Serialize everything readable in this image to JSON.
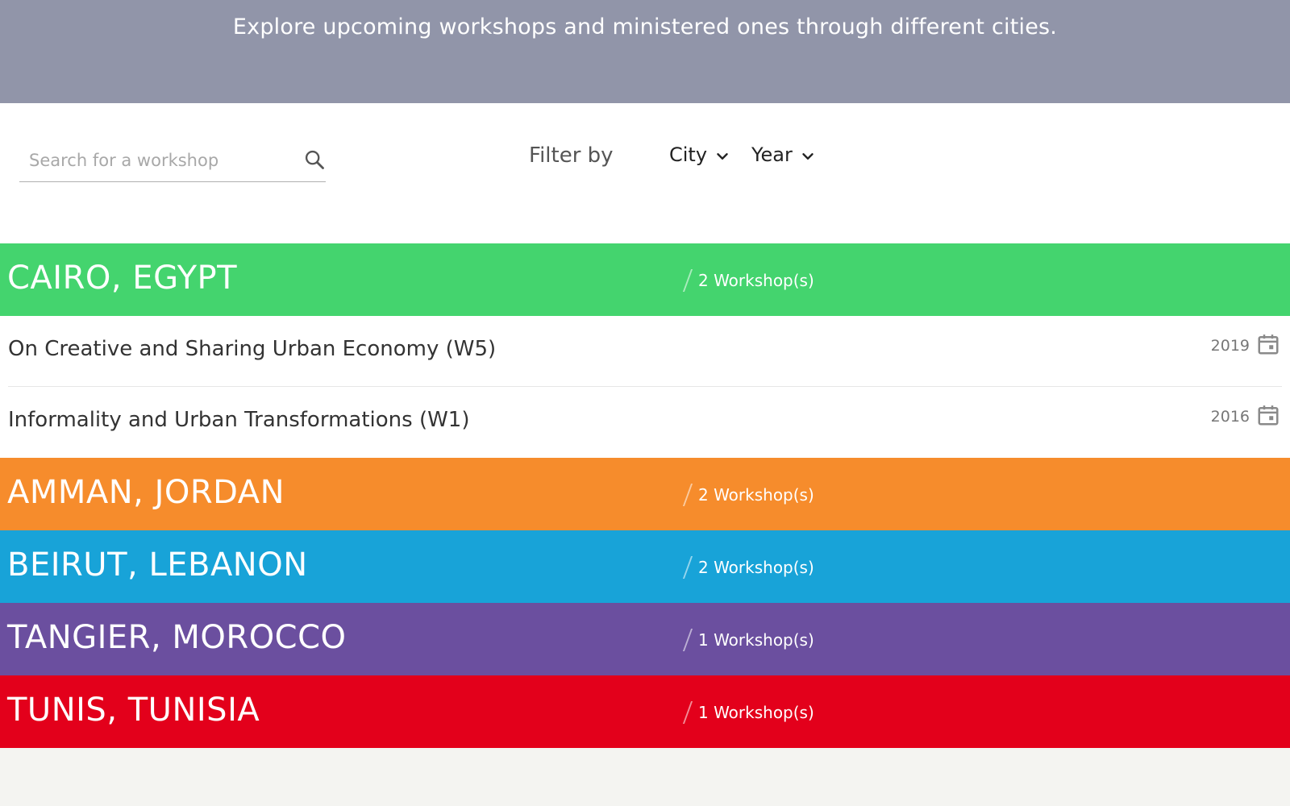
{
  "banner": {
    "text": "Explore upcoming workshops and ministered ones through different cities."
  },
  "search": {
    "placeholder": "Search for a workshop",
    "value": "",
    "icon": "search-icon"
  },
  "filters": {
    "label": "Filter by",
    "city_label": "City",
    "year_label": "Year"
  },
  "cities": [
    {
      "name": "CAIRO, EGYPT",
      "count": "2 Workshop(s)",
      "color": "#44d46e",
      "expanded": true,
      "workshops": [
        {
          "title": "On Creative and Sharing Urban Economy (W5)",
          "year": "2019"
        },
        {
          "title": "Informality and Urban Transformations (W1)",
          "year": "2016"
        }
      ]
    },
    {
      "name": "AMMAN, JORDAN",
      "count": "2 Workshop(s)",
      "color": "#f68c2c"
    },
    {
      "name": "BEIRUT, LEBANON",
      "count": "2 Workshop(s)",
      "color": "#18a3d8"
    },
    {
      "name": "TANGIER, MOROCCO",
      "count": "1 Workshop(s)",
      "color": "#6b4f9f"
    },
    {
      "name": "TUNIS, TUNISIA",
      "count": "1 Workshop(s)",
      "color": "#e3001b"
    }
  ]
}
